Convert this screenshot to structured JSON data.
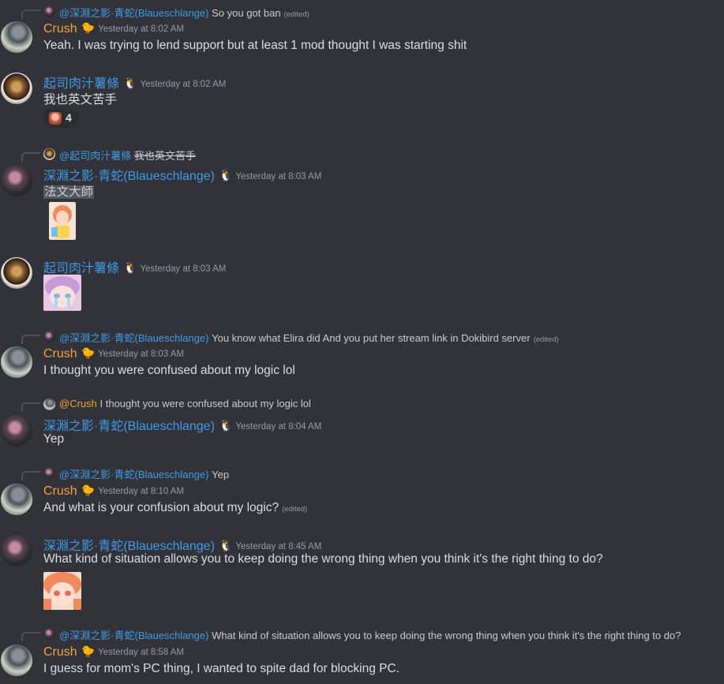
{
  "messages": [
    {
      "reply_author": "@深淵之影·青蛇(Blaueschlange)",
      "reply_text": "So you got ban",
      "reply_edited": "(edited)",
      "author": "Crush",
      "badge": "🐤",
      "time": "Yesterday at 8:02 AM",
      "text": "Yeah. I was trying to lend support but at least 1 mod thought I was starting shit"
    },
    {
      "author": "起司肉汁薯條",
      "badge": "🐧",
      "time": "Yesterday at 8:02 AM",
      "text": "我也英文苦手",
      "reaction_count": "4",
      "reaction_icon": "anime-face-emoji"
    },
    {
      "reply_author": "@起司肉汁薯條",
      "reply_text": "我也英文苦手",
      "author": "深淵之影·青蛇(Blaueschlange)",
      "badge": "🐧",
      "time": "Yesterday at 8:03 AM",
      "text": "法文大師",
      "sticker": "anime-girl-sticker"
    },
    {
      "author": "起司肉汁薯條",
      "badge": "🐧",
      "time": "Yesterday at 8:03 AM",
      "sticker": "anime-girl-crying-sticker"
    },
    {
      "reply_author": "@深淵之影·青蛇(Blaueschlange)",
      "reply_text": "You know what Elira did And you put her stream link in Dokibird server",
      "reply_edited": "(edited)",
      "author": "Crush",
      "badge": "🐤",
      "time": "Yesterday at 8:03 AM",
      "text": "I thought you were confused about my logic lol"
    },
    {
      "reply_author": "@Crush",
      "reply_text": "I thought you were confused about my logic lol",
      "author": "深淵之影·青蛇(Blaueschlange)",
      "badge": "🐧",
      "time": "Yesterday at 8:04 AM",
      "text": "Yep"
    },
    {
      "reply_author": "@深淵之影·青蛇(Blaueschlange)",
      "reply_text": "Yep",
      "author": "Crush",
      "badge": "🐤",
      "time": "Yesterday at 8:10 AM",
      "text": "And what is your confusion about my logic?",
      "edited": "(edited)"
    },
    {
      "author": "深淵之影·青蛇(Blaueschlange)",
      "badge": "🐧",
      "time": "Yesterday at 8:45 AM",
      "text": "What kind of situation allows you to keep doing the wrong thing when you think it's the right thing to do?",
      "sticker": "anime-girl-sticker"
    },
    {
      "reply_author": "@深淵之影·青蛇(Blaueschlange)",
      "reply_text": "What kind of situation allows you to keep doing the wrong thing when you think it's the right thing to do?",
      "author": "Crush",
      "badge": "🐤",
      "time": "Yesterday at 8:58 AM",
      "text": "I guess for mom's PC thing, I wanted to spite dad for blocking PC."
    }
  ],
  "colors": {
    "background": "#313338",
    "crush": "#f0a33a",
    "snake": "#3e9ae8",
    "fries": "#3e9ae8",
    "timestamp": "#949ba4"
  }
}
